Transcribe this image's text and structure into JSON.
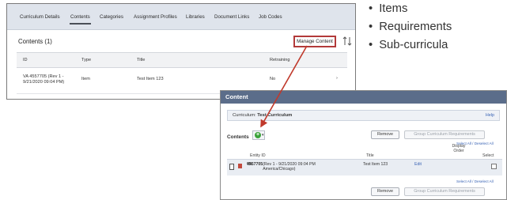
{
  "panel_a": {
    "tabs": [
      "Curriculum Details",
      "Contents",
      "Categories",
      "Assignment Profiles",
      "Libraries",
      "Document Links",
      "Job Codes"
    ],
    "section_title": "Contents (1)",
    "manage_button": "Manage Content",
    "columns": [
      "ID",
      "Type",
      "Title",
      "Retraining"
    ],
    "rows": [
      {
        "id": "VA 4557705 (Rev 1 - 9/21/2020 09:04 PM)",
        "type": "Item",
        "title": "Test Item 123",
        "retraining": "No"
      }
    ]
  },
  "bullets": [
    "Items",
    "Requirements",
    "Sub-curricula"
  ],
  "panel_b": {
    "title": "Content",
    "curriculum_label": "Curriculum:",
    "curriculum_value": "Test Curriculum",
    "help": "Help",
    "contents_label": "Contents",
    "remove_button": "Remove",
    "group_button": "Group Curriculum Requirements",
    "select_all_links": "Select All / Deselect All",
    "columns": {
      "entity_id": "Entity ID",
      "title": "Title",
      "display_order": "Display Order",
      "select": "Select"
    },
    "row": {
      "entity_prefix": "VA ",
      "entity_bold": "4557705",
      "entity_rest": " (Rev 1 - 9/21/2020 09:04 PM America/Chicago)",
      "title": "Test Item 123",
      "edit": "Edit"
    }
  },
  "colors": {
    "highlight_border": "#b23a3a",
    "header_blue": "#5b6d8a",
    "link_blue": "#3a64b5",
    "add_green": "#3aa33a",
    "arrow_red": "#c0392b"
  }
}
